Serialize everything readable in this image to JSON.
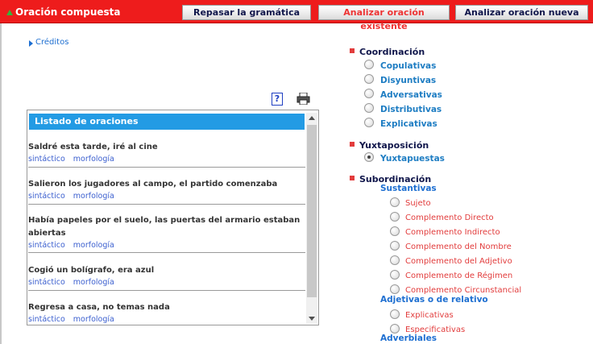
{
  "topbar": {
    "title": "Oración compuesta",
    "buttons": [
      {
        "label": "Repasar la gramática"
      },
      {
        "label": "Analizar oración existente"
      },
      {
        "label": "Analizar oración nueva"
      }
    ]
  },
  "creditos": "Créditos",
  "help_icon_glyph": "?",
  "list": {
    "header": "Listado de oraciones",
    "items": [
      {
        "text": "Saldré esta tarde, iré al cine",
        "link1": "sintáctico",
        "link2": "morfología"
      },
      {
        "text": "Salieron los jugadores al campo, el partido comenzaba",
        "link1": "sintáctico",
        "link2": "morfología"
      },
      {
        "text": "Había papeles por el suelo, las puertas del armario estaban abiertas",
        "link1": "sintáctico",
        "link2": "morfología"
      },
      {
        "text": "Cogió un bolígrafo, era azul",
        "link1": "sintáctico",
        "link2": "morfología"
      },
      {
        "text": "Regresa a casa, no temas nada",
        "link1": "sintáctico",
        "link2": "morfología"
      }
    ]
  },
  "right": {
    "coordinacion": {
      "title": "Coordinación",
      "options": [
        "Copulativas",
        "Disyuntivas",
        "Adversativas",
        "Distributivas",
        "Explicativas"
      ]
    },
    "yuxtaposicion": {
      "title": "Yuxtaposición",
      "options": [
        "Yuxtapuestas"
      ]
    },
    "subordinacion": {
      "title": "Subordinación",
      "sustantivas": {
        "title": "Sustantivas",
        "options": [
          "Sujeto",
          "Complemento Directo",
          "Complemento Indirecto",
          "Complemento del Nombre",
          "Complemento del Adjetivo",
          "Complemento de Régimen",
          "Complemento Circunstancial"
        ]
      },
      "adjetivas": {
        "title": "Adjetivas o de relativo",
        "options": [
          "Explicativas",
          "Especificativas"
        ]
      },
      "adverbiales": {
        "title": "Adverbiales"
      }
    }
  }
}
